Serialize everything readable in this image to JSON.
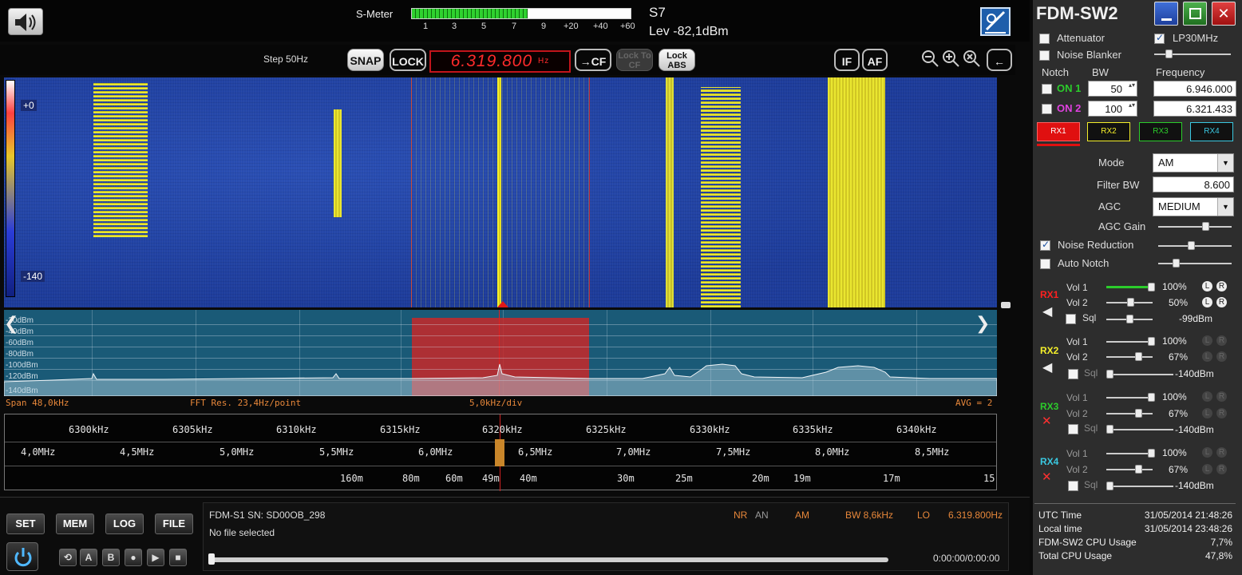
{
  "smeter": {
    "label": "S-Meter",
    "level": 0.53,
    "scale": [
      "1",
      "3",
      "5",
      "7",
      "9",
      "+20",
      "+40",
      "+60"
    ],
    "s_reading": "S7",
    "lev_reading": "Lev -82,1dBm"
  },
  "toolbar": {
    "step": "Step 50Hz",
    "snap": "SNAP",
    "lock": "LOCK",
    "frequency": "6.319.800",
    "freq_unit": "Hz",
    "to_cf": "→CF",
    "lock_to_cf": "Lock To CF",
    "lock_abs": "Lock ABS",
    "if": "IF",
    "af": "AF",
    "back": "←"
  },
  "waterfall": {
    "top_label": "+0",
    "bottom_label": "-140"
  },
  "spectrum": {
    "db_labels": [
      "-20dBm",
      "-40dBm",
      "-60dBm",
      "-80dBm",
      "-100dBm",
      "-120dBm",
      "-140dBm"
    ],
    "nav_left": "❮",
    "nav_right": "❯"
  },
  "info": {
    "span": "Span 48,0kHz",
    "fft": "FFT Res. 23,4Hz/point",
    "div": "5,0kHz/div",
    "avg": "AVG = 2"
  },
  "scale": {
    "khz": [
      "6300kHz",
      "6305kHz",
      "6310kHz",
      "6315kHz",
      "6320kHz",
      "6325kHz",
      "6330kHz",
      "6335kHz",
      "6340kHz"
    ],
    "mhz": [
      "4,0MHz",
      "4,5MHz",
      "5,0MHz",
      "5,5MHz",
      "6,0MHz",
      "6,5MHz",
      "7,0MHz",
      "7,5MHz",
      "8,0MHz",
      "8,5MHz"
    ],
    "bands": [
      "160m",
      "80m",
      "60m",
      "49m",
      "40m",
      "30m",
      "25m",
      "20m",
      "19m",
      "17m",
      "15"
    ]
  },
  "bottom": {
    "set": "SET",
    "mem": "MEM",
    "log": "LOG",
    "file": "FILE",
    "a": "A",
    "b": "B",
    "device": "FDM-S1 SN: SD00OB_298",
    "file_status": "No file selected",
    "nr": "NR",
    "an": "AN",
    "mode": "AM",
    "bw": "BW 8,6kHz",
    "lo_label": "LO",
    "lo_value": "6.319.800Hz",
    "time": "0:00:00/0:00:00"
  },
  "panel": {
    "title": "FDM-SW2",
    "attenuator": "Attenuator",
    "lp30": "LP30MHz",
    "noise_blanker": "Noise Blanker",
    "notch": "Notch",
    "bw": "BW",
    "frequency": "Frequency",
    "on1": "ON 1",
    "on2": "ON 2",
    "notch1_bw": "50",
    "notch2_bw": "100",
    "notch1_freq": "6.946.000",
    "notch2_freq": "6.321.433",
    "rx_tabs": [
      "RX1",
      "RX2",
      "RX3",
      "RX4"
    ],
    "mode_label": "Mode",
    "mode_value": "AM",
    "filter_bw_label": "Filter BW",
    "filter_bw_value": "8.600",
    "agc_label": "AGC",
    "agc_value": "MEDIUM",
    "agc_gain": "AGC Gain",
    "noise_reduction": "Noise Reduction",
    "auto_notch": "Auto Notch",
    "vol1": "Vol 1",
    "vol2": "Vol 2",
    "sql": "Sql",
    "l": "L",
    "r": "R",
    "rx": [
      {
        "name": "RX1",
        "color": "#ff2020",
        "vol1": "100%",
        "vol2": "50%",
        "sql": "-99dBm"
      },
      {
        "name": "RX2",
        "color": "#f4ef2a",
        "vol1": "100%",
        "vol2": "67%",
        "sql": "-140dBm"
      },
      {
        "name": "RX3",
        "color": "#2bcc2b",
        "vol1": "100%",
        "vol2": "67%",
        "sql": "-140dBm"
      },
      {
        "name": "RX4",
        "color": "#3ac8e0",
        "vol1": "100%",
        "vol2": "67%",
        "sql": "-140dBm"
      }
    ]
  },
  "stats": {
    "utc_label": "UTC Time",
    "utc_value": "31/05/2014 21:48:26",
    "local_label": "Local time",
    "local_value": "31/05/2014 23:48:26",
    "cpu_label": "FDM-SW2 CPU Usage",
    "cpu_value": "7,7%",
    "total_label": "Total CPU Usage",
    "total_value": "47,8%"
  }
}
